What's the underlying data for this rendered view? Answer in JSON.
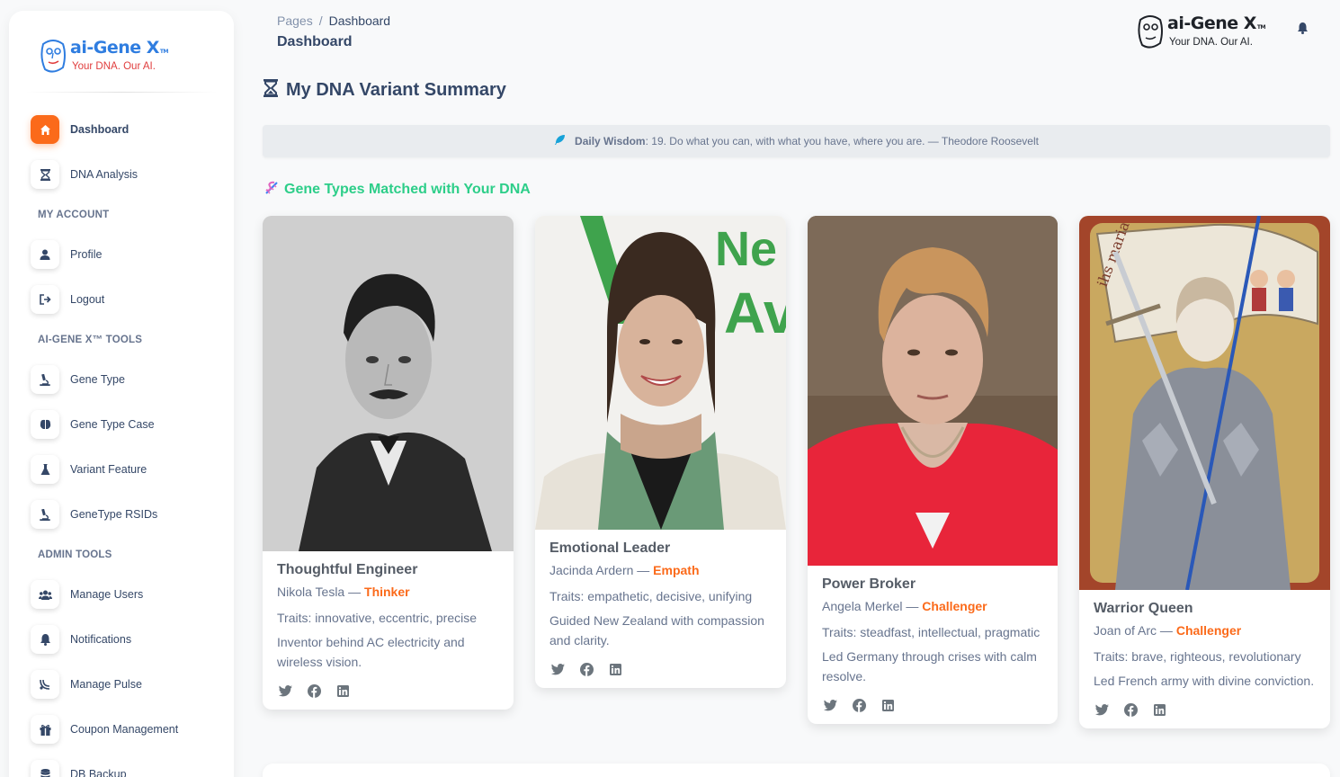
{
  "brand": {
    "name": "ai-Gene X",
    "tm": "TM",
    "tagline": "Your DNA. Our AI."
  },
  "sidebar": {
    "items": [
      {
        "label": "Dashboard",
        "icon": "home-icon",
        "active": true
      },
      {
        "label": "DNA Analysis",
        "icon": "hourglass-icon"
      }
    ],
    "sections": [
      {
        "title": "MY ACCOUNT",
        "items": [
          {
            "label": "Profile",
            "icon": "user-icon"
          },
          {
            "label": "Logout",
            "icon": "logout-icon"
          }
        ]
      },
      {
        "title": "AI-GENE X™ TOOLS",
        "items": [
          {
            "label": "Gene Type",
            "icon": "microscope-icon"
          },
          {
            "label": "Gene Type Case",
            "icon": "brain-icon"
          },
          {
            "label": "Variant Feature",
            "icon": "flask-icon"
          },
          {
            "label": "GeneType RSIDs",
            "icon": "microscope-icon"
          }
        ]
      },
      {
        "title": "ADMIN TOOLS",
        "items": [
          {
            "label": "Manage Users",
            "icon": "users-icon"
          },
          {
            "label": "Notifications",
            "icon": "bell-icon"
          },
          {
            "label": "Manage Pulse",
            "icon": "pulse-icon"
          },
          {
            "label": "Coupon Management",
            "icon": "gift-icon"
          },
          {
            "label": "DB Backup",
            "icon": "database-icon"
          }
        ]
      }
    ]
  },
  "topbar": {
    "breadcrumb_root": "Pages",
    "breadcrumb_sep": "/",
    "breadcrumb_current": "Dashboard",
    "title": "Dashboard"
  },
  "main": {
    "title": "My DNA Variant Summary",
    "wisdom_label": "Daily Wisdom",
    "wisdom_text": ": 19. Do what you can, with what you have, where you are. — Theodore Roosevelt",
    "gene_heading": "Gene Types Matched with Your DNA"
  },
  "cards": [
    {
      "title": "Thoughtful Engineer",
      "person": "Nikola Tesla — ",
      "gene_type": "Thinker",
      "traits": "Traits: innovative, eccentric, precise",
      "desc": "Inventor behind AC electricity and wireless vision."
    },
    {
      "title": "Emotional Leader",
      "person": "Jacinda Ardern — ",
      "gene_type": "Empath",
      "traits": "Traits: empathetic, decisive, unifying",
      "desc": "Guided New Zealand with compassion and clarity."
    },
    {
      "title": "Power Broker",
      "person": "Angela Merkel — ",
      "gene_type": "Challenger",
      "traits": "Traits: steadfast, intellectual, pragmatic",
      "desc": "Led Germany through crises with calm resolve."
    },
    {
      "title": "Warrior Queen",
      "person": "Joan of Arc — ",
      "gene_type": "Challenger",
      "traits": "Traits: brave, righteous, revolutionary",
      "desc": "Led French army with divine conviction."
    }
  ],
  "colors": {
    "accent": "#fb6a1a",
    "green": "#2dce89",
    "text": "#344767",
    "muted": "#67748e"
  }
}
